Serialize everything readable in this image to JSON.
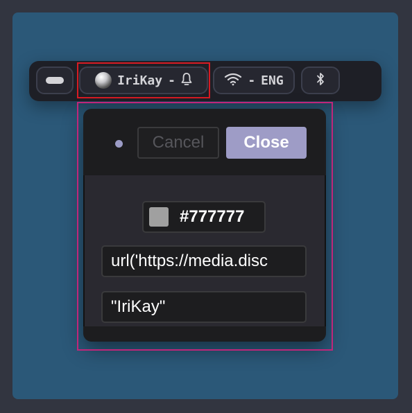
{
  "colors": {
    "outer_background": "#323540",
    "wallpaper": "#2b5878",
    "bar_background": "#1e1f26",
    "accent": "#9e9cc6",
    "highlight_red": "#d81b23",
    "highlight_magenta": "#c0267a",
    "swatch": "#a0a0a0"
  },
  "bar": {
    "workspace_indicator": {
      "icon": "workspace-dash-icon"
    },
    "user_module": {
      "avatar_icon": "avatar-orb-icon",
      "username": "IriKay",
      "separator": "-",
      "bell_icon": "bell-icon"
    },
    "network_module": {
      "wifi_icon": "wifi-icon",
      "separator": "-",
      "language": "ENG"
    },
    "bluetooth_module": {
      "icon": "bluetooth-icon"
    }
  },
  "popup": {
    "status_dot_icon": "status-dot-icon",
    "cancel_label": "Cancel",
    "close_label": "Close",
    "color_value": "#777777",
    "url_value": "url('https://media.disc",
    "name_value": "\"IriKay\""
  }
}
